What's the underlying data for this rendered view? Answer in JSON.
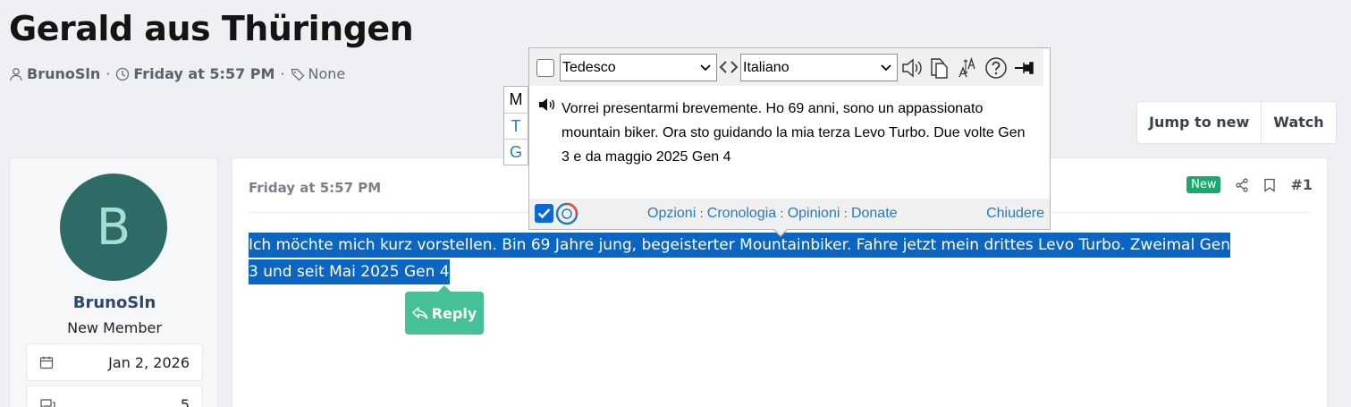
{
  "thread": {
    "title": "Gerald aus Thüringen",
    "author": "BrunoSln",
    "date": "Friday at 5:57 PM",
    "tags": "None",
    "sep": "·"
  },
  "actions": {
    "jump_to_new": "Jump to new",
    "watch": "Watch"
  },
  "user": {
    "avatar_letter": "B",
    "name": "BrunoSln",
    "title": "New Member",
    "joined": "Jan 2, 2026",
    "messages": "5"
  },
  "post": {
    "date": "Friday at 5:57 PM",
    "badge": "New",
    "number": "#1",
    "line1": "Ich möchte mich kurz vorstellen. Bin 69 Jahre jung, begeisterter Mountainbiker. Fahre jetzt mein drittes Levo Turbo. Zweimal Gen",
    "line2": "3 und seit Mai 2025 Gen 4",
    "reply": "Reply"
  },
  "translator": {
    "from_lang": "Tedesco",
    "to_lang": "Italiano",
    "side": [
      "M",
      "T",
      "G"
    ],
    "text": "Vorrei presentarmi brevemente. Ho 69 anni, sono un appassionato mountain biker. Ora sto guidando la mia terza Levo Turbo. Due volte Gen 3 e da maggio 2025 Gen 4",
    "links": {
      "options": "Opzioni",
      "history": "Cronologia",
      "feedback": "Opinioni",
      "donate": "Donate",
      "sep": ":"
    },
    "close": "Chiudere"
  }
}
